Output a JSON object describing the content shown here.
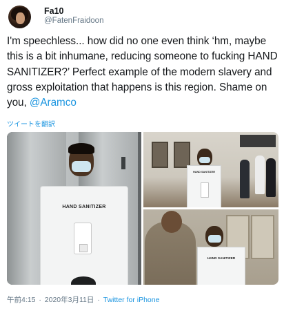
{
  "author": {
    "display_name": "Fa10",
    "handle": "@FatenFraidoon"
  },
  "tweet": {
    "text_main": "I'm speechless... how did no one even think ‘hm, maybe this is a bit inhumane, reducing someone to fucking HAND SANITIZER?’ Perfect example of the modern slavery and gross exploitation that happens is this region. Shame on you, ",
    "mention": "@Aramco",
    "translate_label": "ツイートを翻訳"
  },
  "media": {
    "photo_1_label": "HAND SANITIZER",
    "photo_2_label": "HAND SANITIZER",
    "photo_3_label": "HAND SANITIZER"
  },
  "meta": {
    "time": "午前4:15",
    "separator": "·",
    "date": "2020年3月11日",
    "client": "Twitter for iPhone"
  },
  "colors": {
    "link": "#1b95e0",
    "text": "#14171a",
    "muted": "#657786"
  }
}
